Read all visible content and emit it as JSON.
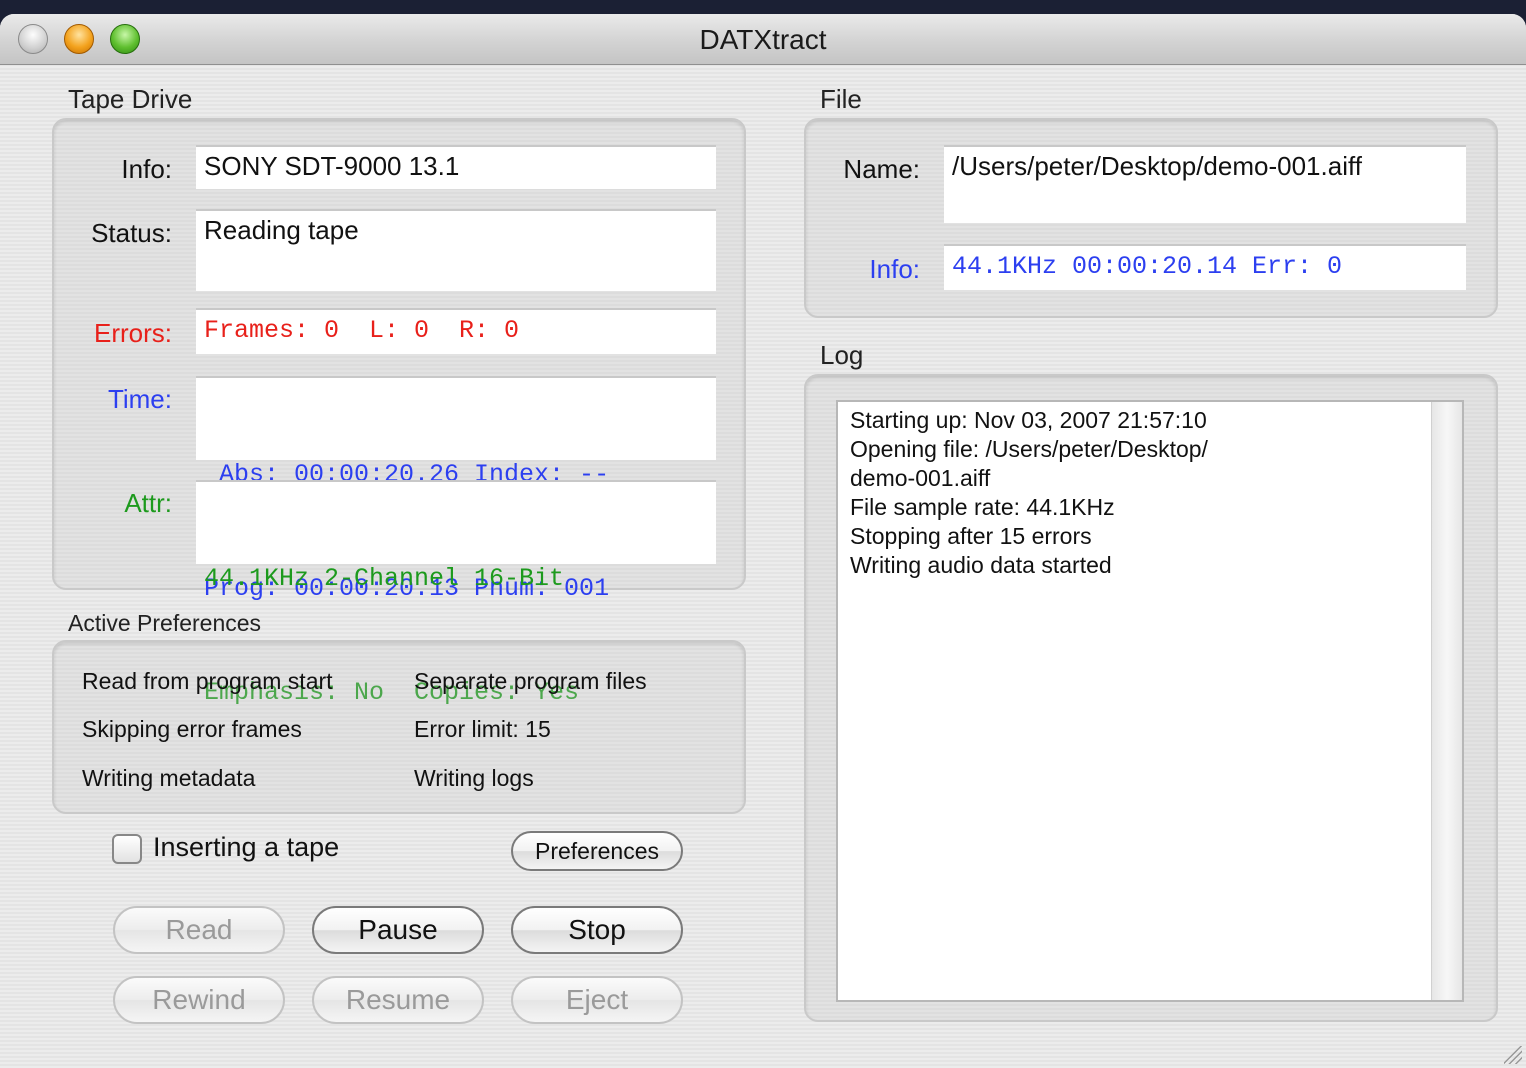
{
  "window": {
    "title": "DATXtract"
  },
  "tape_drive": {
    "label": "Tape Drive",
    "info_label": "Info:",
    "info_value": "SONY SDT-9000 13.1",
    "status_label": "Status:",
    "status_value": "Reading tape",
    "errors_label": "Errors:",
    "errors_value": "Frames: 0  L: 0  R: 0",
    "time_label": "Time:",
    "time_line1": " Abs: 00:00:20.26 Index: --",
    "time_line2": "Prog: 00:00:20.13 Pnum: 001",
    "attr_label": "Attr:",
    "attr_line1": "44.1KHz 2-Channel 16-Bit",
    "attr_line2": "Emphasis: No  Copies: Yes"
  },
  "active_preferences": {
    "label": "Active Preferences",
    "items": [
      "Read from program start",
      "Separate program files",
      "Skipping error frames",
      "Error limit: 15",
      "Writing metadata",
      "Writing logs"
    ]
  },
  "controls": {
    "inserting_tape_label": "Inserting a tape",
    "preferences_label": "Preferences",
    "read_label": "Read",
    "pause_label": "Pause",
    "stop_label": "Stop",
    "rewind_label": "Rewind",
    "resume_label": "Resume",
    "eject_label": "Eject"
  },
  "file": {
    "label": "File",
    "name_label": "Name:",
    "name_value": "/Users/peter/Desktop/demo-001.aiff",
    "info_label": "Info:",
    "info_value": "44.1KHz 00:00:20.14 Err: 0"
  },
  "log": {
    "label": "Log",
    "lines": [
      "Starting up: Nov 03, 2007 21:57:10",
      "Opening file: /Users/peter/Desktop/",
      "demo-001.aiff",
      "File sample rate: 44.1KHz",
      "Stopping after 15 errors",
      "Writing audio data started"
    ]
  },
  "colors": {
    "error_text": "#e8201a",
    "time_text": "#2c3ff0",
    "attr_text": "#1d9a1d"
  }
}
